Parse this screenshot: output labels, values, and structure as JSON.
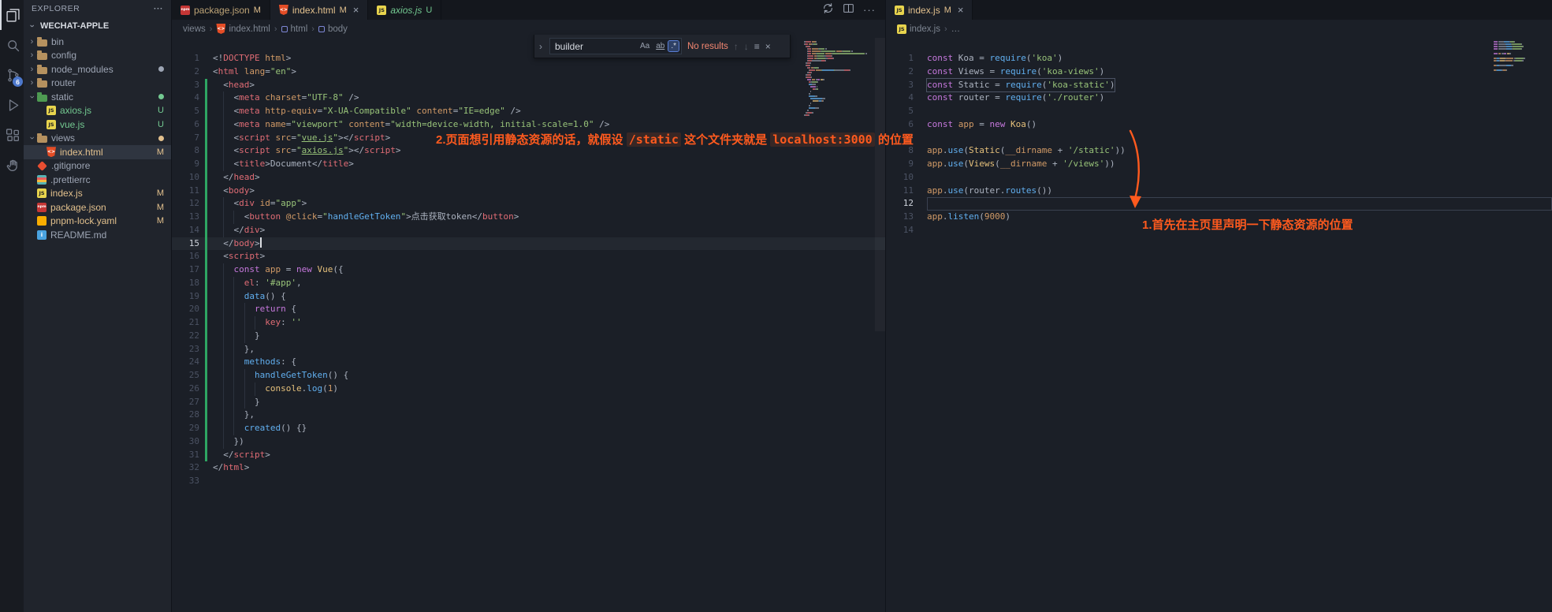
{
  "colors": {
    "annotation": "#ff5a1e",
    "git_modified": "#e2c08d",
    "git_untracked": "#73c991",
    "scm_badge_bg": "#4d78cc",
    "find_no_results": "#f48771"
  },
  "activity_bar": {
    "items": [
      {
        "name": "explorer",
        "active": true
      },
      {
        "name": "search"
      },
      {
        "name": "source-control",
        "badge": "6"
      },
      {
        "name": "run-debug"
      },
      {
        "name": "extensions"
      },
      {
        "name": "hand"
      }
    ]
  },
  "sidebar": {
    "title": "EXPLORER",
    "more_label": "···",
    "section": "WECHAT-APPLE",
    "items": [
      {
        "label": "bin",
        "kind": "folder",
        "depth": 0,
        "expanded": false
      },
      {
        "label": "config",
        "kind": "folder",
        "depth": 0,
        "expanded": false
      },
      {
        "label": "node_modules",
        "kind": "folder",
        "depth": 0,
        "expanded": false,
        "dot": "#9da5b4"
      },
      {
        "label": "router",
        "kind": "folder",
        "depth": 0,
        "expanded": false
      },
      {
        "label": "static",
        "kind": "folder",
        "folder_color": "#4e9a52",
        "depth": 0,
        "expanded": true,
        "dot": "#73c991"
      },
      {
        "label": "axios.js",
        "kind": "js",
        "depth": 1,
        "badge": "U",
        "color": "#73c991"
      },
      {
        "label": "vue.js",
        "kind": "js",
        "depth": 1,
        "badge": "U",
        "color": "#73c991"
      },
      {
        "label": "views",
        "kind": "folder",
        "depth": 0,
        "expanded": true,
        "dot": "#e2c08d"
      },
      {
        "label": "index.html",
        "kind": "html",
        "depth": 1,
        "badge": "M",
        "color": "#e2c08d",
        "selected": true
      },
      {
        "label": ".gitignore",
        "kind": "git",
        "depth": 0
      },
      {
        "label": ".prettierrc",
        "kind": "prettier",
        "depth": 0
      },
      {
        "label": "index.js",
        "kind": "js",
        "depth": 0,
        "badge": "M",
        "color": "#e2c08d"
      },
      {
        "label": "package.json",
        "kind": "npm",
        "depth": 0,
        "badge": "M",
        "color": "#e2c08d"
      },
      {
        "label": "pnpm-lock.yaml",
        "kind": "pnpm",
        "depth": 0,
        "badge": "M",
        "color": "#e2c08d"
      },
      {
        "label": "README.md",
        "kind": "md",
        "depth": 0
      }
    ]
  },
  "left_editor": {
    "tabs": [
      {
        "label": "package.json",
        "badge": "M",
        "icon": "npm",
        "active": false,
        "color": "#bda376"
      },
      {
        "label": "index.html",
        "badge": "M",
        "icon": "html",
        "active": true,
        "color": "#e2c08d",
        "close": "×"
      },
      {
        "label": "axios.js",
        "badge": "U",
        "icon": "js",
        "active": false,
        "italic": true,
        "color": "#73c991"
      }
    ],
    "actions": [
      {
        "name": "sync"
      },
      {
        "name": "split"
      },
      {
        "name": "more",
        "label": "···"
      }
    ],
    "breadcrumb": [
      {
        "label": "views"
      },
      {
        "label": "index.html",
        "icon": "html"
      },
      {
        "label": "html",
        "icon": "symbol"
      },
      {
        "label": "body",
        "icon": "symbol"
      }
    ],
    "find": {
      "query": "builder",
      "results": "No results",
      "options": [
        {
          "label": "Aa",
          "name": "match-case"
        },
        {
          "label": "ab",
          "name": "whole-word",
          "underline": true
        },
        {
          "label": ".*",
          "name": "regex",
          "active": true
        }
      ],
      "buttons": [
        {
          "label": "↑",
          "name": "find-prev",
          "dim": true
        },
        {
          "label": "↓",
          "name": "find-next",
          "dim": true
        },
        {
          "label": "≡",
          "name": "find-in-selection"
        },
        {
          "label": "×",
          "name": "find-close"
        }
      ]
    },
    "annotation": {
      "pre": "2.页面想引用静态资源的话，就假设 ",
      "code1": "/static",
      "mid": " 这个文件夹就是 ",
      "code2": "localhost:3000",
      "post": " 的位置"
    },
    "code": {
      "current_line": 15,
      "cursor_line": 15,
      "changed_from": 3,
      "changed_to": 31,
      "lines": [
        [
          [
            "p",
            "<!"
          ],
          [
            "t",
            "DOCTYPE"
          ],
          [
            "a",
            " html"
          ],
          [
            "p",
            ">"
          ]
        ],
        [
          [
            "p",
            "<"
          ],
          [
            "t",
            "html"
          ],
          [
            "a",
            " lang"
          ],
          [
            "p",
            "="
          ],
          [
            "s",
            "\"en\""
          ],
          [
            "p",
            ">"
          ]
        ],
        [
          [
            "p",
            "  <"
          ],
          [
            "t",
            "head"
          ],
          [
            "p",
            ">"
          ]
        ],
        [
          [
            "p",
            "    <"
          ],
          [
            "t",
            "meta"
          ],
          [
            "a",
            " charset"
          ],
          [
            "p",
            "="
          ],
          [
            "s",
            "\"UTF-8\""
          ],
          [
            "p",
            " />"
          ]
        ],
        [
          [
            "p",
            "    <"
          ],
          [
            "t",
            "meta"
          ],
          [
            "a",
            " http-equiv"
          ],
          [
            "p",
            "="
          ],
          [
            "s",
            "\"X-UA-Compatible\""
          ],
          [
            "a",
            " content"
          ],
          [
            "p",
            "="
          ],
          [
            "s",
            "\"IE=edge\""
          ],
          [
            "p",
            " />"
          ]
        ],
        [
          [
            "p",
            "    <"
          ],
          [
            "t",
            "meta"
          ],
          [
            "a",
            " name"
          ],
          [
            "p",
            "="
          ],
          [
            "s",
            "\"viewport\""
          ],
          [
            "a",
            " content"
          ],
          [
            "p",
            "="
          ],
          [
            "s",
            "\"width=device-width, initial-scale=1.0\""
          ],
          [
            "p",
            " />"
          ]
        ],
        [
          [
            "p",
            "    <"
          ],
          [
            "t",
            "script"
          ],
          [
            "a",
            " src"
          ],
          [
            "p",
            "="
          ],
          [
            "s",
            "\""
          ],
          [
            "su",
            "vue.js"
          ],
          [
            "s",
            "\""
          ],
          [
            "p",
            "></"
          ],
          [
            "t",
            "script"
          ],
          [
            "p",
            ">"
          ]
        ],
        [
          [
            "p",
            "    <"
          ],
          [
            "t",
            "script"
          ],
          [
            "a",
            " src"
          ],
          [
            "p",
            "="
          ],
          [
            "s",
            "\""
          ],
          [
            "su",
            "axios.js"
          ],
          [
            "s",
            "\""
          ],
          [
            "p",
            "></"
          ],
          [
            "t",
            "script"
          ],
          [
            "p",
            ">"
          ]
        ],
        [
          [
            "p",
            "    <"
          ],
          [
            "t",
            "title"
          ],
          [
            "p",
            ">Document</"
          ],
          [
            "t",
            "title"
          ],
          [
            "p",
            ">"
          ]
        ],
        [
          [
            "p",
            "  </"
          ],
          [
            "t",
            "head"
          ],
          [
            "p",
            ">"
          ]
        ],
        [
          [
            "p",
            "  <"
          ],
          [
            "t",
            "body"
          ],
          [
            "p",
            ">"
          ]
        ],
        [
          [
            "p",
            "    <"
          ],
          [
            "t",
            "div"
          ],
          [
            "a",
            " id"
          ],
          [
            "p",
            "="
          ],
          [
            "s",
            "\"app\""
          ],
          [
            "p",
            ">"
          ]
        ],
        [
          [
            "p",
            "      <"
          ],
          [
            "t",
            "button"
          ],
          [
            "a",
            " @click"
          ],
          [
            "p",
            "="
          ],
          [
            "s",
            "\""
          ],
          [
            "f",
            "handleGetToken"
          ],
          [
            "s",
            "\""
          ],
          [
            "p",
            ">点击获取token</"
          ],
          [
            "t",
            "button"
          ],
          [
            "p",
            ">"
          ]
        ],
        [
          [
            "p",
            "    </"
          ],
          [
            "t",
            "div"
          ],
          [
            "p",
            ">"
          ]
        ],
        [
          [
            "p",
            "  </"
          ],
          [
            "t",
            "body"
          ],
          [
            "p",
            ">"
          ]
        ],
        [
          [
            "p",
            "  <"
          ],
          [
            "t",
            "script"
          ],
          [
            "p",
            ">"
          ]
        ],
        [
          [
            "p",
            "    "
          ],
          [
            "k",
            "const"
          ],
          [
            "n",
            " app"
          ],
          [
            "p",
            " = "
          ],
          [
            "k",
            "new"
          ],
          [
            "c",
            " Vue"
          ],
          [
            "p",
            "({"
          ]
        ],
        [
          [
            "p",
            "      "
          ],
          [
            "v",
            "el"
          ],
          [
            "p",
            ": "
          ],
          [
            "s",
            "'#app'"
          ],
          [
            "p",
            ","
          ]
        ],
        [
          [
            "p",
            "      "
          ],
          [
            "f",
            "data"
          ],
          [
            "p",
            "() {"
          ]
        ],
        [
          [
            "p",
            "        "
          ],
          [
            "k",
            "return"
          ],
          [
            "p",
            " {"
          ]
        ],
        [
          [
            "p",
            "          "
          ],
          [
            "v",
            "key"
          ],
          [
            "p",
            ": "
          ],
          [
            "s",
            "''"
          ]
        ],
        [
          [
            "p",
            "        }"
          ]
        ],
        [
          [
            "p",
            "      },"
          ]
        ],
        [
          [
            "p",
            "      "
          ],
          [
            "f",
            "methods"
          ],
          [
            "p",
            ": {"
          ]
        ],
        [
          [
            "p",
            "        "
          ],
          [
            "f",
            "handleGetToken"
          ],
          [
            "p",
            "() {"
          ]
        ],
        [
          [
            "p",
            "          "
          ],
          [
            "c",
            "console"
          ],
          [
            "p",
            "."
          ],
          [
            "f",
            "log"
          ],
          [
            "p",
            "("
          ],
          [
            "n",
            "1"
          ],
          [
            "p",
            ")"
          ]
        ],
        [
          [
            "p",
            "        }"
          ]
        ],
        [
          [
            "p",
            "      },"
          ]
        ],
        [
          [
            "p",
            "      "
          ],
          [
            "f",
            "created"
          ],
          [
            "p",
            "() {}"
          ]
        ],
        [
          [
            "p",
            "    })"
          ]
        ],
        [
          [
            "p",
            "  </"
          ],
          [
            "t",
            "script"
          ],
          [
            "p",
            ">"
          ]
        ],
        [
          [
            "p",
            "</"
          ],
          [
            "t",
            "html"
          ],
          [
            "p",
            ">"
          ]
        ],
        []
      ]
    }
  },
  "right_editor": {
    "tabs": [
      {
        "label": "index.js",
        "badge": "M",
        "icon": "js",
        "active": true,
        "color": "#e2c08d",
        "close": "×"
      }
    ],
    "breadcrumb": [
      {
        "label": "index.js",
        "icon": "js"
      },
      {
        "label": "…"
      }
    ],
    "annotation": {
      "text": "1.首先在主页里声明一下静态资源的位置"
    },
    "code": {
      "border_line": 12,
      "boxed_line": 3,
      "lines": [
        [
          [
            "k",
            "const"
          ],
          [
            "p",
            " Koa = "
          ],
          [
            "f",
            "require"
          ],
          [
            "p",
            "("
          ],
          [
            "s",
            "'koa'"
          ],
          [
            "p",
            ")"
          ]
        ],
        [
          [
            "k",
            "const"
          ],
          [
            "p",
            " Views = "
          ],
          [
            "f",
            "require"
          ],
          [
            "p",
            "("
          ],
          [
            "s",
            "'koa-views'"
          ],
          [
            "p",
            ")"
          ]
        ],
        [
          [
            "k",
            "const"
          ],
          [
            "p",
            " Static = "
          ],
          [
            "f",
            "require"
          ],
          [
            "p",
            "("
          ],
          [
            "s",
            "'koa-static'"
          ],
          [
            "p",
            ")"
          ]
        ],
        [
          [
            "k",
            "const"
          ],
          [
            "p",
            " router = "
          ],
          [
            "f",
            "require"
          ],
          [
            "p",
            "("
          ],
          [
            "s",
            "'./router'"
          ],
          [
            "p",
            ")"
          ]
        ],
        [],
        [
          [
            "k",
            "const"
          ],
          [
            "n",
            " app"
          ],
          [
            "p",
            " = "
          ],
          [
            "k",
            "new"
          ],
          [
            "c",
            " Koa"
          ],
          [
            "p",
            "()"
          ]
        ],
        [],
        [
          [
            "n",
            "app"
          ],
          [
            "p",
            "."
          ],
          [
            "f",
            "use"
          ],
          [
            "p",
            "("
          ],
          [
            "c",
            "Static"
          ],
          [
            "p",
            "("
          ],
          [
            "n",
            "__dirname"
          ],
          [
            "p",
            " + "
          ],
          [
            "s",
            "'/static'"
          ],
          [
            "p",
            "))"
          ]
        ],
        [
          [
            "n",
            "app"
          ],
          [
            "p",
            "."
          ],
          [
            "f",
            "use"
          ],
          [
            "p",
            "("
          ],
          [
            "c",
            "Views"
          ],
          [
            "p",
            "("
          ],
          [
            "n",
            "__dirname"
          ],
          [
            "p",
            " + "
          ],
          [
            "s",
            "'/views'"
          ],
          [
            "p",
            "))"
          ]
        ],
        [],
        [
          [
            "n",
            "app"
          ],
          [
            "p",
            "."
          ],
          [
            "f",
            "use"
          ],
          [
            "p",
            "("
          ],
          [
            "p",
            "router"
          ],
          [
            "p",
            "."
          ],
          [
            "f",
            "routes"
          ],
          [
            "p",
            "())"
          ]
        ],
        [],
        [
          [
            "n",
            "app"
          ],
          [
            "p",
            "."
          ],
          [
            "f",
            "listen"
          ],
          [
            "p",
            "("
          ],
          [
            "n",
            "9000"
          ],
          [
            "p",
            ")"
          ]
        ],
        []
      ]
    }
  }
}
